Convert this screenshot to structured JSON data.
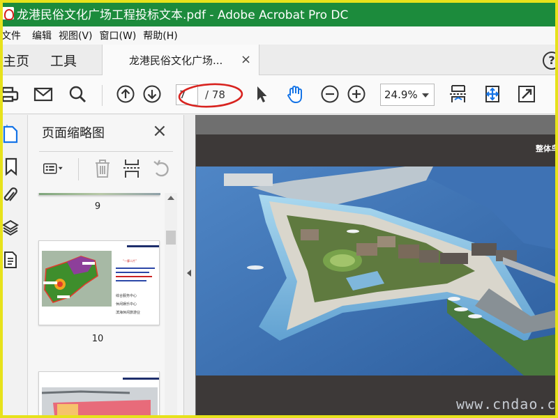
{
  "window": {
    "title": "龙港民俗文化广场工程投标文本.pdf - Adobe Acrobat Pro DC"
  },
  "menu": [
    "文件",
    "编辑",
    "视图(V)",
    "窗口(W)",
    "帮助(H)"
  ],
  "tabs": {
    "home": "主页",
    "tools": "工具",
    "document": "龙港民俗文化广场...",
    "close": "×",
    "help": "?"
  },
  "toolbar": {
    "current_page": "7",
    "total_pages": "/ 78",
    "zoom": "24.9%"
  },
  "panel": {
    "title": "页面缩略图",
    "close": "×",
    "pages": [
      {
        "number": "9"
      },
      {
        "number": "10",
        "lines": [
          "“一廊二片”",
          "综合服务中心",
          "休闲娱乐中心",
          "滨海休闲旅游业"
        ]
      },
      {
        "number": ""
      }
    ]
  },
  "document": {
    "header": "整体鸟"
  },
  "annotation": {
    "color": "#d8231f"
  },
  "colors": {
    "titlebar": "#1c8b3c",
    "frame": "#e7e21b",
    "accent": "#1473e6"
  },
  "watermark": "www.cndao.com"
}
